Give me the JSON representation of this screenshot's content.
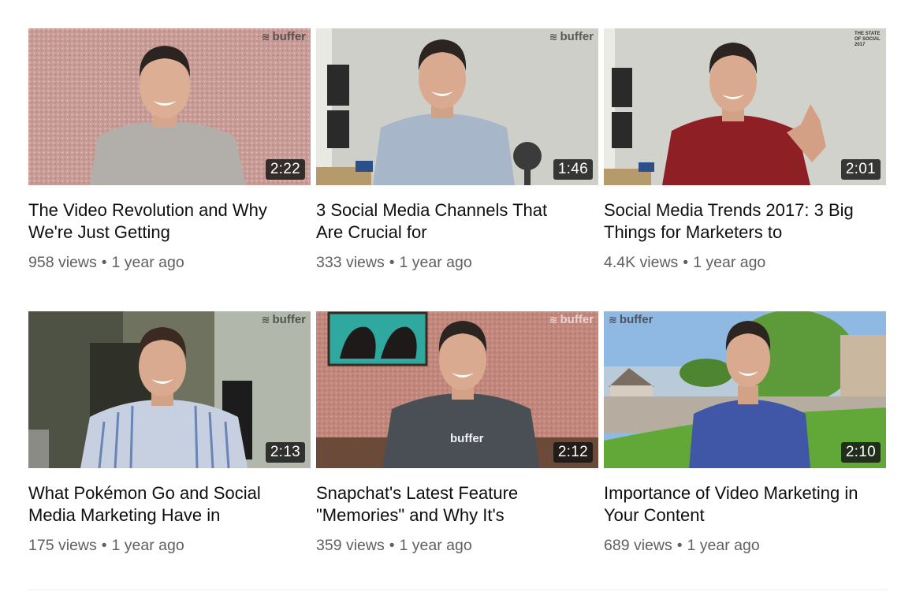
{
  "videos": [
    {
      "title": "The Video Revolution and Why We're Just Getting",
      "views": "958 views",
      "age": "1 year ago",
      "duration": "2:22",
      "watermark": "buffer"
    },
    {
      "title": "3 Social Media Channels That Are Crucial for",
      "views": "333 views",
      "age": "1 year ago",
      "duration": "1:46",
      "watermark": "buffer"
    },
    {
      "title": "Social Media Trends 2017: 3 Big Things for Marketers to",
      "views": "4.4K views",
      "age": "1 year ago",
      "duration": "2:01",
      "watermark": "THE STATE OF SOCIAL 2017"
    },
    {
      "title": "What Pokémon Go and Social Media Marketing Have in",
      "views": "175 views",
      "age": "1 year ago",
      "duration": "2:13",
      "watermark": "buffer"
    },
    {
      "title": "Snapchat's Latest Feature \"Memories\" and Why It's",
      "views": "359 views",
      "age": "1 year ago",
      "duration": "2:12",
      "watermark": "buffer",
      "shirt_logo": "buffer"
    },
    {
      "title": "Importance of Video Marketing in Your Content",
      "views": "689 views",
      "age": "1 year ago",
      "duration": "2:10",
      "watermark": "buffer"
    }
  ],
  "separator": "•",
  "icons": {
    "watermark_logo": "buffer-stack-icon"
  }
}
